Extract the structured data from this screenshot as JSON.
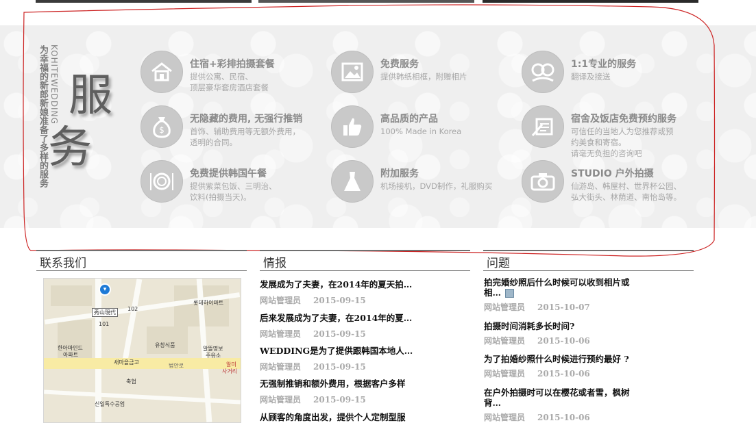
{
  "service": {
    "vertical_en": "KOHITEWEDDING",
    "vertical_zh": "为幸福的新郎新娘准备了多样的服务",
    "title_char1": "服",
    "title_char2": "务",
    "items": [
      {
        "title": "住宿+彩排拍摄套餐",
        "desc": [
          "提供公寓、民宿、",
          "顶层豪华套房酒店套餐"
        ],
        "icon": "house-icon"
      },
      {
        "title": "免费服务",
        "desc": [
          "提供韩纸相框，附赠相片"
        ],
        "icon": "picture-icon"
      },
      {
        "title": "1:1专业的服务",
        "desc": [
          "翻译及接送"
        ],
        "icon": "couple-icon"
      },
      {
        "title": "无隐藏的费用, 无强行推销",
        "desc": [
          "首饰、辅助费用等无额外费用，",
          "透明的合同。"
        ],
        "icon": "money-bag-icon"
      },
      {
        "title": "高品质的产品",
        "desc": [
          "100% Made in Korea"
        ],
        "icon": "thumbs-up-icon"
      },
      {
        "title": "宿舍及饭店免费预约服务",
        "desc": [
          "可信任的当地人为您推荐或预",
          "约美食和寄宿。",
          "请毫无负担的咨询吧"
        ],
        "icon": "pen-paper-icon"
      },
      {
        "title": "免费提供韩国午餐",
        "desc": [
          "提供紫菜包饭、三明治、",
          "饮料(拍摄当天)。"
        ],
        "icon": "plate-icon"
      },
      {
        "title": "附加服务",
        "desc": [
          "机场接机，DVD制作，礼服购买"
        ],
        "icon": "dress-icon"
      },
      {
        "title": "STUDIO 户外拍摄",
        "desc": [
          "仙游岛、韩屋村、世界杯公园、",
          "弘大街头、林荫道、南怡岛等。"
        ],
        "icon": "camera-icon"
      }
    ]
  },
  "contact": {
    "header": "联系我们",
    "map_labels": {
      "hotel": "秀山現代",
      "lotte": "롯데하이마트",
      "hanmaind": "한아마인드",
      "apt": "아파트",
      "yusang": "유창식품",
      "aldeul": "알뜰명보",
      "juyuso": "주유소",
      "saema": "새마을금고",
      "chukhyup": "축협",
      "beoman": "법안로",
      "almi": "알미",
      "sageori": "사거리",
      "sinil": "신일특수공업",
      "num": "102",
      "num2": "101"
    }
  },
  "news": {
    "header": "情报",
    "items": [
      {
        "title": "发展成为了夫妻，在2014年的夏天拍…",
        "author": "网站管理员",
        "date": "2015-09-15"
      },
      {
        "title": "后来发展成为了夫妻，在2014年的夏…",
        "author": "网站管理员",
        "date": "2015-09-15"
      },
      {
        "title": "WEDDING是为了提供跟韩国本地人…",
        "author": "网站管理员",
        "date": "2015-09-15"
      },
      {
        "title": "无强制推销和额外费用，根据客户多样",
        "author": "网站管理员",
        "date": "2015-09-15"
      },
      {
        "title": "从顾客的角度出发，提供个人定制型服",
        "author": "",
        "date": ""
      }
    ]
  },
  "qa": {
    "header": "问题",
    "items": [
      {
        "title_l1": "拍完婚纱照后什么时候可以收到相片或",
        "title_l2": "相…",
        "author": "网站管理员",
        "date": "2015-10-07"
      },
      {
        "title_l1": "拍摄时间消耗多长时间?",
        "title_l2": "",
        "author": "网站管理员",
        "date": "2015-10-06"
      },
      {
        "title_l1": "为了拍婚纱照什么时候进行预约最好 ?",
        "title_l2": "",
        "author": "网站管理员",
        "date": "2015-10-06"
      },
      {
        "title_l1": "在户外拍摄时可以在樱花或者雪，枫树",
        "title_l2": "背…",
        "author": "网站管理员",
        "date": "2015-10-06"
      }
    ]
  },
  "colors": {
    "annotation": "#cc2222",
    "header_rule": "#6f6f6f"
  }
}
